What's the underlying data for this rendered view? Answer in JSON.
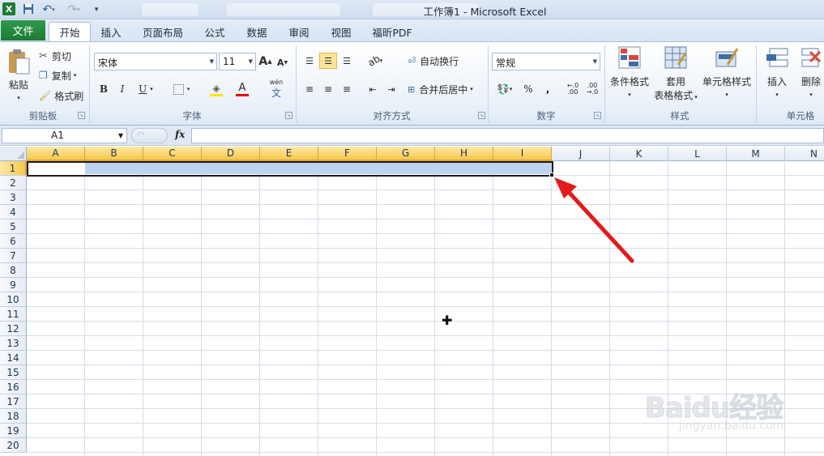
{
  "window": {
    "title": "工作簿1 - Microsoft Excel",
    "app_icon": "X"
  },
  "tabs": {
    "file": "文件",
    "items": [
      "开始",
      "插入",
      "页面布局",
      "公式",
      "数据",
      "审阅",
      "视图",
      "福昕PDF"
    ],
    "active": "开始"
  },
  "ribbon": {
    "clipboard": {
      "paste": "粘贴",
      "cut": "剪切",
      "copy": "复制",
      "format_painter": "格式刷",
      "group": "剪贴板"
    },
    "font": {
      "name": "宋体",
      "size": "11",
      "bold": "B",
      "italic": "I",
      "underline": "U",
      "grow": "A",
      "shrink": "A",
      "font_color": "A",
      "phonetic": "wén",
      "group": "字体"
    },
    "alignment": {
      "wrap": "自动换行",
      "merge": "合并后居中",
      "group": "对齐方式"
    },
    "number": {
      "format": "常规",
      "percent": "%",
      "comma": ",",
      "inc_decimal": "←.0 .00",
      "dec_decimal": ".00 →.0",
      "group": "数字"
    },
    "styles": {
      "conditional": "条件格式",
      "table_line1": "套用",
      "table_line2": "表格格式",
      "cell_styles": "单元格样式",
      "group": "样式"
    },
    "cells": {
      "insert": "插入",
      "delete": "删除",
      "group": "单元格"
    }
  },
  "formula_bar": {
    "name_box": "A1",
    "fx": "fx",
    "value": ""
  },
  "grid": {
    "columns": [
      "A",
      "B",
      "C",
      "D",
      "E",
      "F",
      "G",
      "H",
      "I",
      "J",
      "K",
      "L",
      "M",
      "N"
    ],
    "selected_columns": [
      "A",
      "B",
      "C",
      "D",
      "E",
      "F",
      "G",
      "H",
      "I"
    ],
    "rows": [
      "1",
      "2",
      "3",
      "4",
      "5",
      "6",
      "7",
      "8",
      "9",
      "10",
      "11",
      "12",
      "13",
      "14",
      "15",
      "16",
      "17",
      "18",
      "19",
      "20"
    ],
    "selected_row": "1",
    "selection": "A1:I1"
  },
  "colors": {
    "file_tab": "#1d7a36",
    "selection_fill": "#bed4ee",
    "header_selected": "#f6c84a",
    "arrow": "#e21b1b"
  },
  "watermark": {
    "text": "Baidu经验",
    "sub": "jingyan.baidu.com"
  }
}
